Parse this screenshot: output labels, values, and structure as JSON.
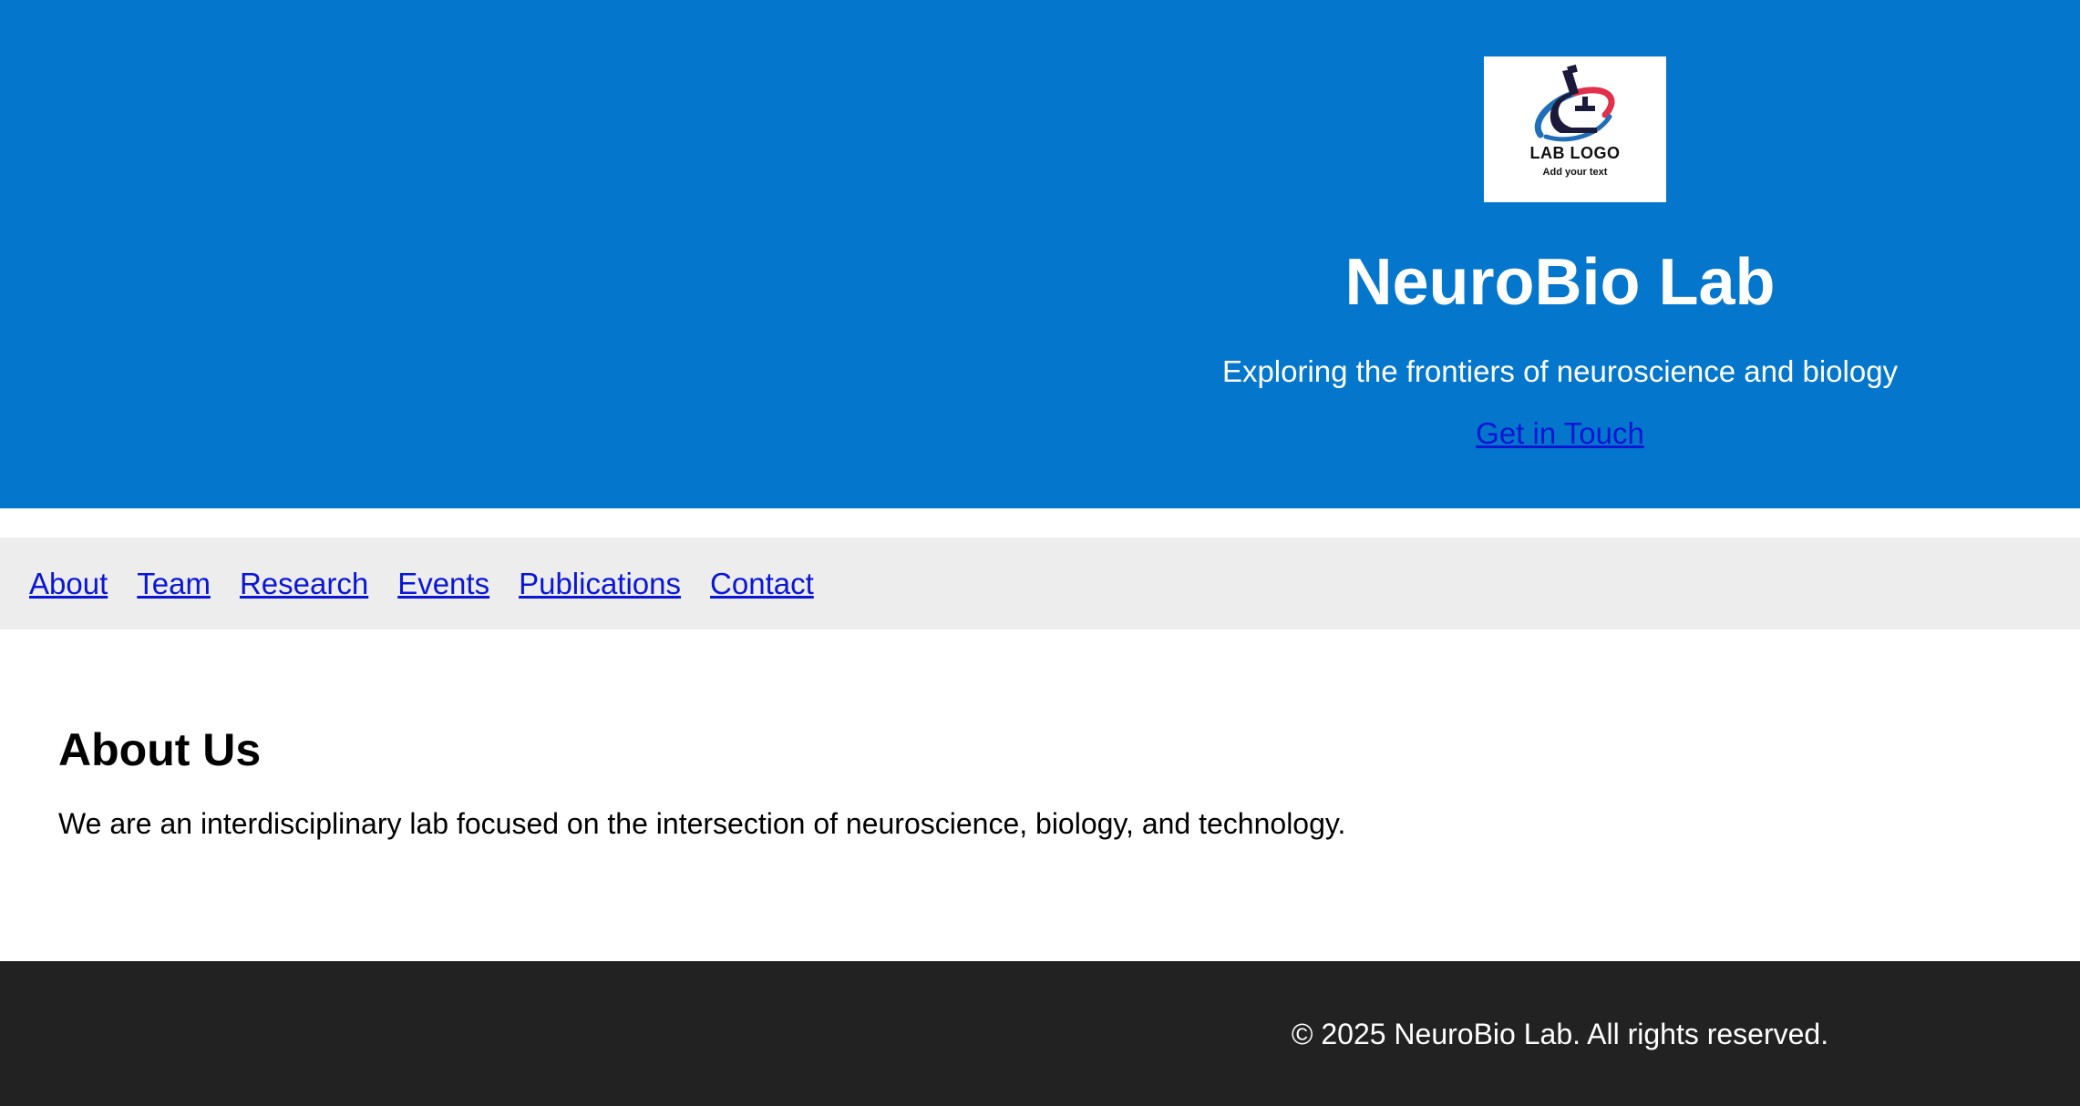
{
  "hero": {
    "logo": {
      "alt": "Lab logo",
      "main_text": "LAB LOGO",
      "sub_text": "Add your text",
      "icon": "microscope-icon"
    },
    "title": "NeuroBio Lab",
    "subtitle": "Exploring the frontiers of neuroscience and biology",
    "cta_label": "Get in Touch"
  },
  "nav": {
    "items": [
      {
        "label": "About"
      },
      {
        "label": "Team"
      },
      {
        "label": "Research"
      },
      {
        "label": "Events"
      },
      {
        "label": "Publications"
      },
      {
        "label": "Contact"
      }
    ]
  },
  "about": {
    "heading": "About Us",
    "body": "We are an interdisciplinary lab focused on the intersection of neuroscience, biology, and technology."
  },
  "footer": {
    "copyright": "© 2025 NeuroBio Lab. All rights reserved."
  },
  "colors": {
    "hero_bg": "#0477cc",
    "link": "#0a16d6",
    "nav_bg": "#ededed",
    "footer_bg": "#222222"
  }
}
